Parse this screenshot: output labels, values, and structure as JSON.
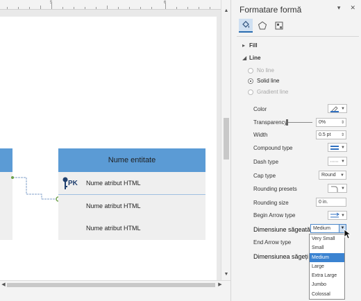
{
  "canvas": {
    "ruler_numbers": [
      "5",
      "6"
    ],
    "entity": {
      "title": "Nume entitate",
      "pk_label": "PK",
      "rows": [
        "Nume atribut HTML",
        "Nume atribut HTML",
        "Nume atribut HTML"
      ]
    }
  },
  "panel": {
    "title": "Formatare formă",
    "fill_label": "Fill",
    "line_label": "Line",
    "line_options": [
      "No line",
      "Solid line",
      "Gradient line"
    ],
    "props": {
      "color": "Color",
      "transparency": "Transparency",
      "transparency_value": "0%",
      "width": "Width",
      "width_value": "0.5 pt",
      "compound": "Compound type",
      "dash": "Dash type",
      "cap": "Cap type",
      "cap_value": "Round",
      "rounding_presets": "Rounding presets",
      "rounding_size": "Rounding size",
      "rounding_size_value": "0 in.",
      "begin_arrow": "Begin Arrow type",
      "begin_arrow_size": "Dimensiune săgeată Sta",
      "end_arrow": "End Arrow type",
      "end_arrow_size": "Dimensiunea săgeți"
    },
    "dropdown": {
      "selected": "Medium",
      "options": [
        "Very Small",
        "Small",
        "Medium",
        "Large",
        "Extra Large",
        "Jumbo",
        "Colossal"
      ],
      "highlighted_index": 2
    }
  },
  "colors": {
    "entity_header": "#5b9bd5",
    "accent": "#3b83d1"
  }
}
